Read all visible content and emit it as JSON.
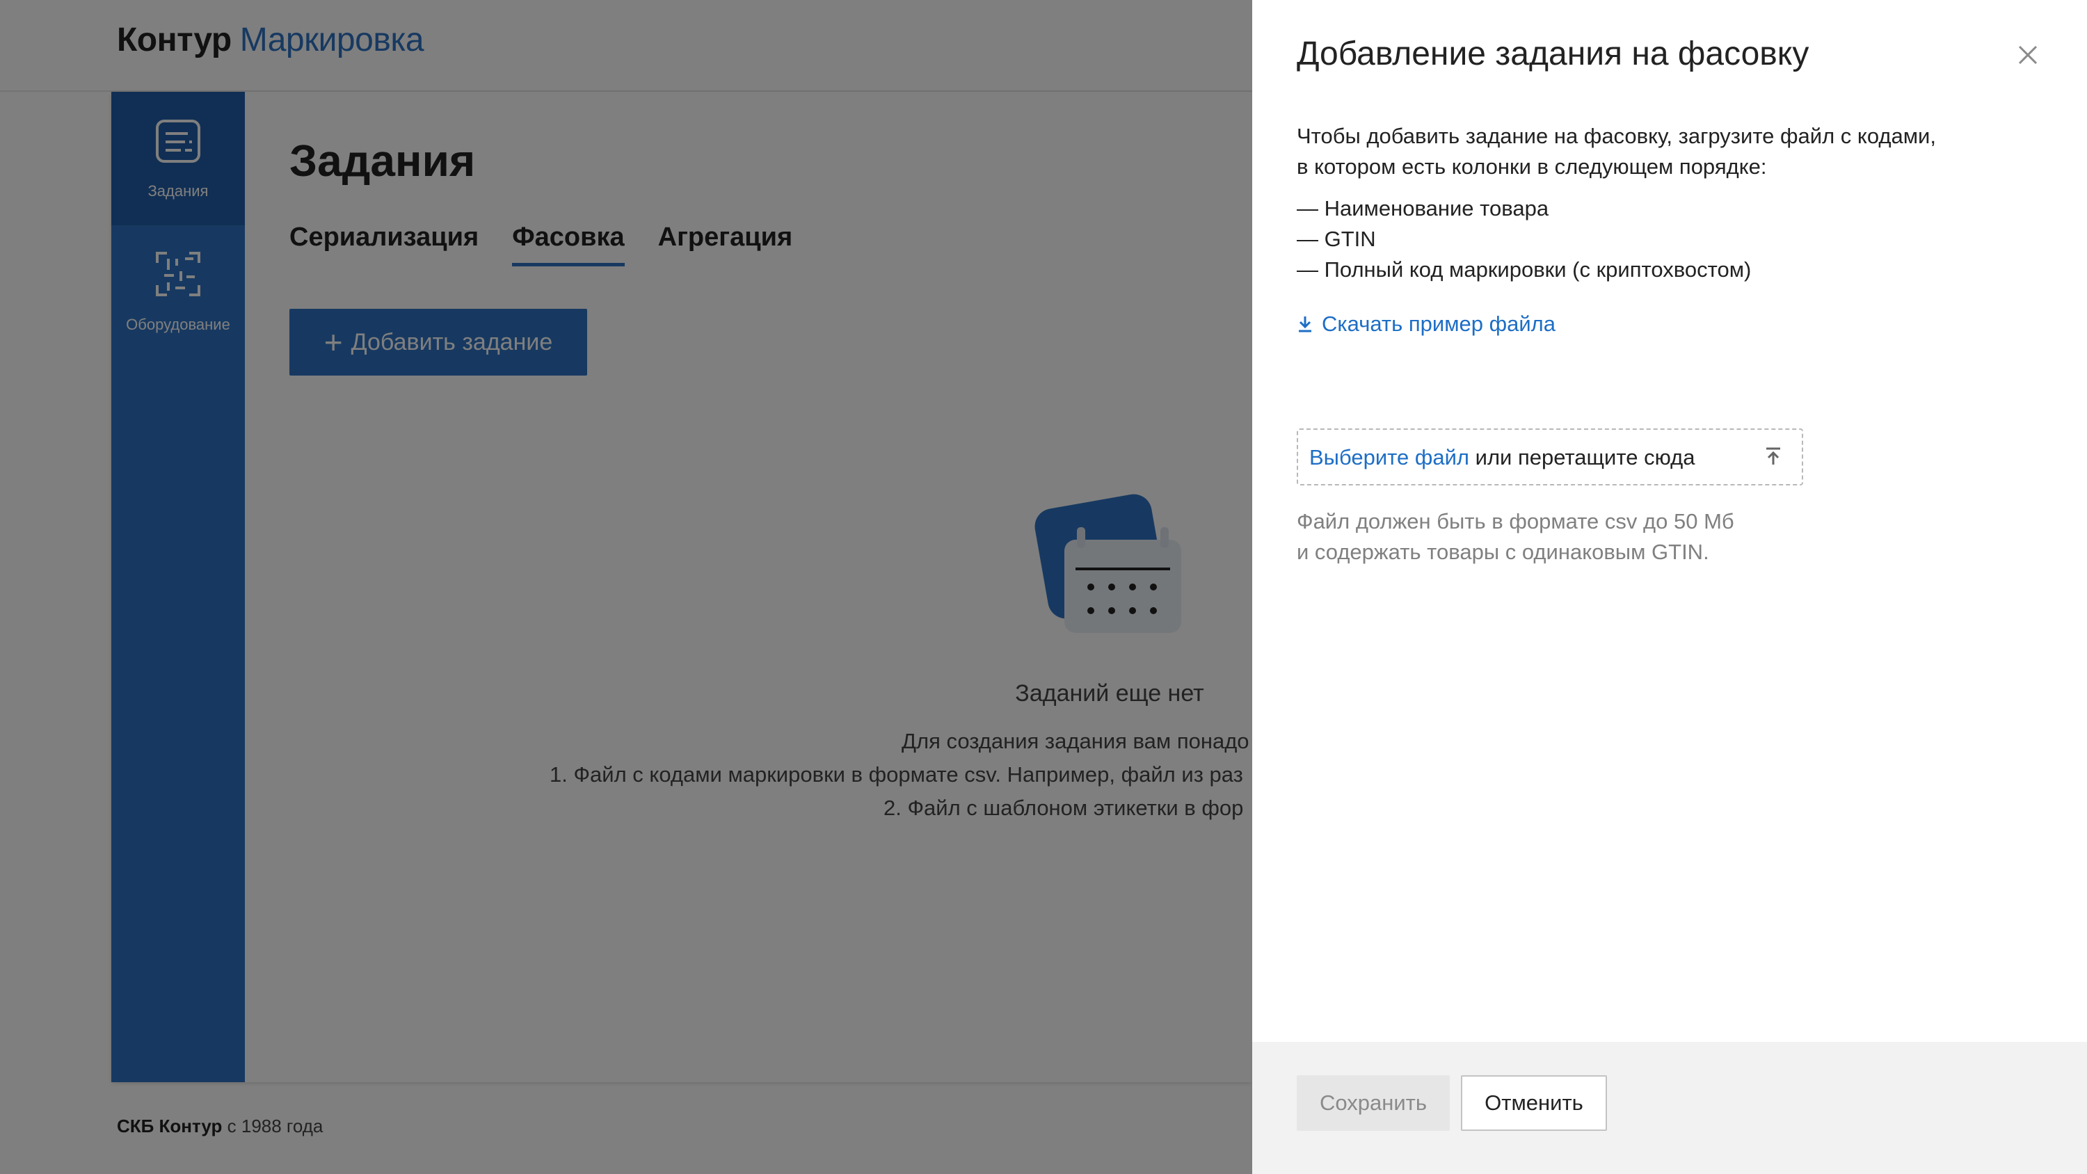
{
  "header": {
    "brand": "Контур",
    "product": "Маркировка"
  },
  "sidebar": {
    "items": [
      {
        "label": "Задания",
        "icon": "tasks-list-icon",
        "active": true
      },
      {
        "label": "Оборудование",
        "icon": "equipment-qr-icon",
        "active": false
      }
    ]
  },
  "main": {
    "title": "Задания",
    "tabs": [
      {
        "label": "Сериализация",
        "active": false
      },
      {
        "label": "Фасовка",
        "active": true
      },
      {
        "label": "Агрегация",
        "active": false
      }
    ],
    "add_button": {
      "icon": "plus-icon",
      "label": "Добавить задание"
    },
    "empty_state": {
      "title": "Заданий еще нет",
      "lines": [
        "Для создания задания вам понадо",
        "1. Файл с кодами маркировки в формате csv. Например, файл из раз",
        "2. Файл с шаблоном этикетки в фор"
      ]
    }
  },
  "footer": {
    "company": "СКБ Контур",
    "since": " с 1988 года"
  },
  "panel": {
    "title": "Добавление задания на фасовку",
    "close_icon": "close-icon",
    "intro": [
      "Чтобы добавить задание на фасовку, загрузите файл с кодами,",
      "в котором есть колонки в следующем порядке:"
    ],
    "columns": [
      "— Наименование товара",
      "— GTIN",
      "— Полный код маркировки (с криптохвостом)"
    ],
    "download_link": {
      "icon": "download-icon",
      "label": "Скачать пример файла"
    },
    "dropzone": {
      "link": "Выберите файл",
      "text": " или перетащите сюда",
      "icon": "upload-icon"
    },
    "hint": [
      "Файл должен быть в формате csv до 50 Мб",
      "и содержать товары с одинаковым GTIN."
    ],
    "buttons": {
      "save": "Сохранить",
      "cancel": "Отменить"
    }
  },
  "colors": {
    "accent": "#2e72c3",
    "link": "#1d6ec5",
    "overlay": "rgba(0,0,0,0.5)"
  }
}
